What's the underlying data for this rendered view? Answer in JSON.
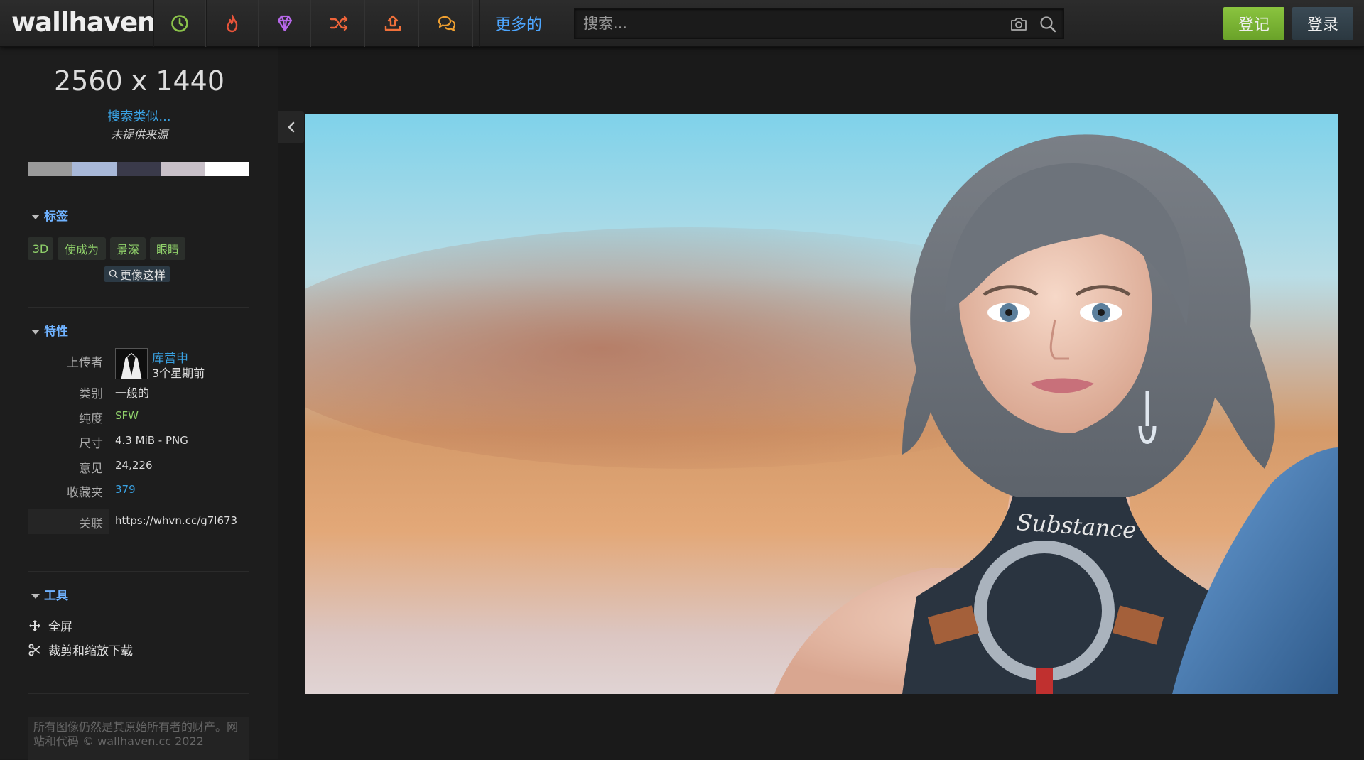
{
  "header": {
    "logo": "wallhaven",
    "nav_icons": [
      {
        "name": "latest-icon",
        "color": "#8bc34a"
      },
      {
        "name": "hot-icon",
        "color": "#e8543a"
      },
      {
        "name": "toplist-icon",
        "color": "#b667e8"
      },
      {
        "name": "random-icon",
        "color": "#f0643a"
      },
      {
        "name": "upload-icon",
        "color": "#f0703a"
      },
      {
        "name": "forums-icon",
        "color": "#f0a030"
      }
    ],
    "more_label": "更多的",
    "search_placeholder": "搜索...",
    "register_label": "登记",
    "login_label": "登录"
  },
  "sidebar": {
    "resolution": "2560 x 1440",
    "search_similar": "搜索类似...",
    "no_source": "未提供来源",
    "palette": [
      "#9a9a9a",
      "#a8b8d8",
      "#3a3a4a",
      "#c8c0c8",
      "#ffffff"
    ],
    "tags_heading": "标签",
    "tags": [
      "3D",
      "使成为",
      "景深",
      "眼睛"
    ],
    "more_like_this": "更像这样",
    "properties_heading": "特性",
    "properties": {
      "uploader_label": "上传者",
      "uploader_name": "库营申",
      "uploaded_time": "3个星期前",
      "category_label": "类别",
      "category_value": "一般的",
      "purity_label": "纯度",
      "purity_value": "SFW",
      "size_label": "尺寸",
      "size_value": "4.3 MiB - PNG",
      "views_label": "意见",
      "views_value": "24,226",
      "favorites_label": "收藏夹",
      "favorites_value": "379",
      "link_label": "关联",
      "link_value": "https://whvn.cc/g7l673"
    },
    "tools_heading": "工具",
    "tools": [
      "全屏",
      "裁剪和缩放下载"
    ],
    "footer_text": "所有图像仍然是其原始所有者的财产。网站和代码 © wallhaven.cc 2022"
  },
  "wallpaper": {
    "shirt_text": "Substance"
  }
}
